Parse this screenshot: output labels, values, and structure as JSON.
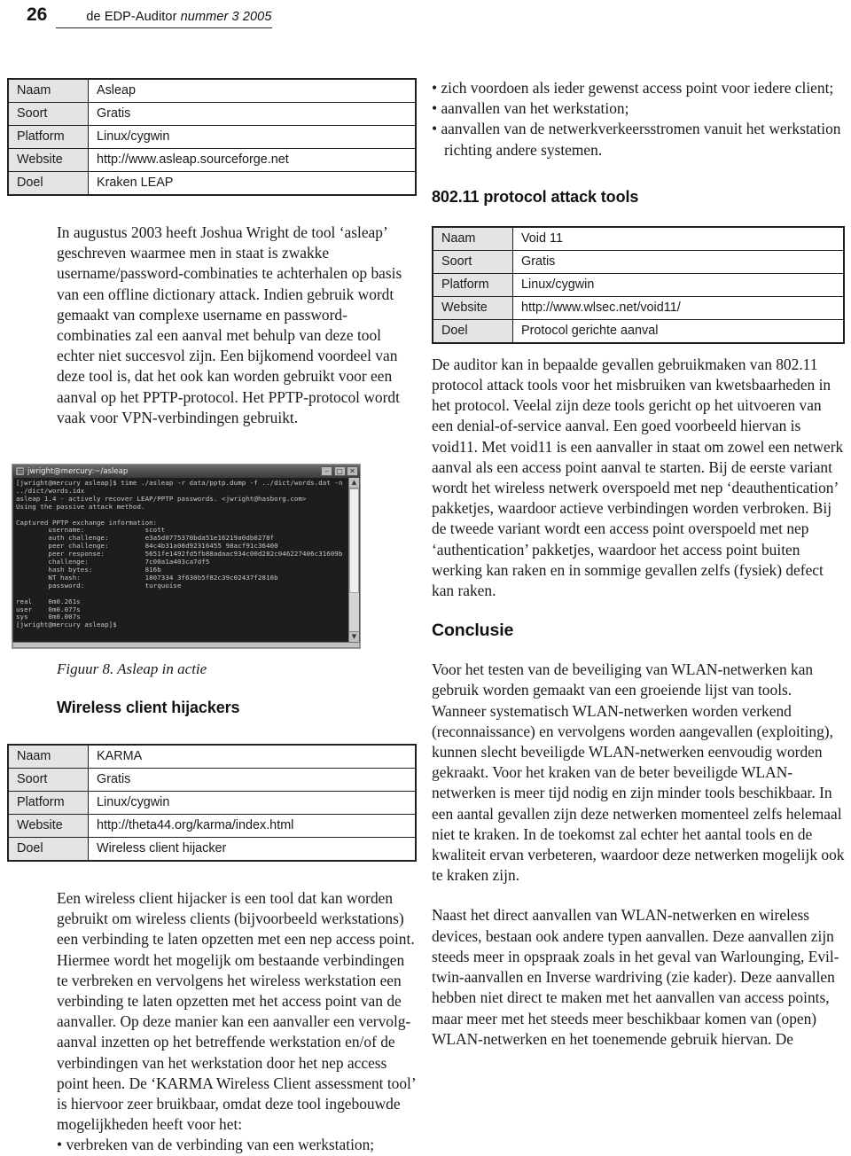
{
  "header": {
    "folio": "26",
    "title_plain": "de EDP-Auditor ",
    "title_italic": "nummer 3 2005"
  },
  "left_column": {
    "asleap_table": {
      "rows": [
        {
          "key": "Naam",
          "value": "Asleap"
        },
        {
          "key": "Soort",
          "value": "Gratis"
        },
        {
          "key": "Platform",
          "value": "Linux/cygwin"
        },
        {
          "key": "Website",
          "value": "http://www.asleap.sourceforge.net"
        },
        {
          "key": "Doel",
          "value": "Kraken LEAP"
        }
      ]
    },
    "asleap_paragraph": "In augustus 2003 heeft Joshua Wright de tool ‘asleap’ geschreven waarmee men in staat is zwakke username/password-combinaties te achterhalen op basis van een offline dictionary attack. Indien gebruik wordt gemaakt van complexe username en password-combinaties zal een aanval met behulp van deze tool echter niet succesvol zijn. Een bijkomend voordeel van deze tool is, dat het ook kan worden gebruikt voor een aanval op het PPTP-protocol. Het PPTP-protocol wordt vaak voor VPN-verbindingen gebruikt.",
    "terminal": {
      "title": "jwright@mercury:~/asleap",
      "minimize_label": "–",
      "maximize_label": "□",
      "close_label": "✕",
      "scroll_up_label": "▲",
      "scroll_down_label": "▼",
      "content": "[jwright@mercury asleap]$ time ./asleap -r data/pptp.dump -f ../dict/words.dat -n\n../dict/words.idx\nasleap 1.4 - actively recover LEAP/PPTP passwords. <jwright@hasborg.com>\nUsing the passive attack method.\n\nCaptured PPTP exchange information:\n        username:               scott\n        auth challenge:         e3a5d0775370bda51e16219a0db0278f\n        peer challenge:         84c4b31a00d92316455 98acf91c36400\n        peer response:          5651fe1492fd5fb88adaac934c00d282c046227406c31609b\n        challenge:              7c00a1a403ca7df5\n        hash bytes:             816b\n        NT hash:                1807334 3f630b5f82c39c02437f2816b\n        password:               turquoise\n\nreal    0m0.261s\nuser    0m0.077s\nsys     0m0.007s\n[jwright@mercury asleap]$ "
    },
    "figure_caption": "Figuur 8. Asleap in actie",
    "hijackers_heading": "Wireless client hijackers",
    "karma_table": {
      "rows": [
        {
          "key": "Naam",
          "value": "KARMA"
        },
        {
          "key": "Soort",
          "value": "Gratis"
        },
        {
          "key": "Platform",
          "value": "Linux/cygwin"
        },
        {
          "key": "Website",
          "value": "http://theta44.org/karma/index.html"
        },
        {
          "key": "Doel",
          "value": "Wireless client hijacker"
        }
      ]
    },
    "karma_paragraph": "Een wireless client hijacker is een tool dat kan worden gebruikt om wireless clients (bijvoorbeeld werkstations) een verbinding te laten opzetten met een nep access point. Hiermee wordt het mogelijk om bestaande verbindingen te verbreken en vervolgens het wireless werkstation een verbinding te laten opzetten met het access point van de aanvaller. Op deze manier kan een aanvaller een vervolg-aanval inzetten op het betreffende werkstation en/of de verbindingen van het werkstation door het nep access point heen. De ‘KARMA Wireless Client assessment tool’ is hiervoor zeer bruikbaar, omdat deze tool ingebouwde mogelijkheden heeft voor het:",
    "bullets_continued": [
      "verbreken van de verbinding van een werkstation;"
    ]
  },
  "right_column": {
    "bullets_top": [
      "zich voordoen als ieder gewenst access point voor iedere client;",
      "aanvallen van het werkstation;",
      "aanvallen van de netwerkverkeersstromen vanuit het werkstation richting andere systemen."
    ],
    "protocol_heading": "802.11 protocol attack tools",
    "void11_table": {
      "rows": [
        {
          "key": "Naam",
          "value": "Void 11"
        },
        {
          "key": "Soort",
          "value": "Gratis"
        },
        {
          "key": "Platform",
          "value": "Linux/cygwin"
        },
        {
          "key": "Website",
          "value": "http://www.wlsec.net/void11/"
        },
        {
          "key": "Doel",
          "value": "Protocol gerichte aanval"
        }
      ]
    },
    "void11_paragraph": "De auditor kan in bepaalde gevallen gebruikmaken van 802.11 protocol attack tools voor het misbruiken van kwetsbaarheden in het protocol. Veelal zijn deze tools gericht op het uitvoeren van een denial-of-service aanval. Een goed voorbeeld hiervan is void11. Met void11 is een aanvaller in staat om zowel een netwerk aanval als een access point aanval te starten. Bij de eerste variant wordt het wireless netwerk overspoeld met nep ‘deauthentication’ pakketjes, waardoor actieve verbindingen worden verbroken. Bij de tweede variant wordt een access point overspoeld met nep ‘authentication’ pakketjes, waardoor het access point buiten werking kan raken en in sommige gevallen zelfs (fysiek) defect kan raken.",
    "conclusie_heading": "Conclusie",
    "conclusie_paragraph_1": "Voor het testen van de beveiliging van WLAN-netwerken kan gebruik worden gemaakt van een groeiende lijst van tools. Wanneer systematisch WLAN-netwerken worden verkend (reconnaissance) en vervolgens worden aangevallen (exploiting), kunnen slecht beveiligde WLAN-netwerken eenvoudig worden gekraakt. Voor het kraken van de beter beveiligde WLAN-netwerken is meer tijd nodig en zijn minder tools beschikbaar. In een aantal gevallen zijn deze netwerken momenteel zelfs helemaal niet te kraken. In de toekomst zal echter het aantal tools en de kwaliteit ervan verbeteren, waardoor deze netwerken mogelijk ook te kraken zijn.",
    "conclusie_paragraph_2": "Naast het direct aanvallen van WLAN-netwerken en wireless devices, bestaan ook andere typen aanvallen. Deze aanvallen zijn steeds meer in opspraak zoals in het geval van Warlounging, Evil-twin-aanvallen en Inverse wardriving (zie kader). Deze aanvallen hebben niet direct te maken met het aanvallen van access points, maar meer met het steeds meer beschikbaar komen van (open) WLAN-netwerken en het toenemende gebruik hiervan. De"
  },
  "colors": {
    "table_key_bg": "#e3e4e6",
    "table_border": "#231f20",
    "text": "#1a1a1a",
    "terminal_bg": "#1d1d1d",
    "terminal_text": "#c9c9c9"
  }
}
